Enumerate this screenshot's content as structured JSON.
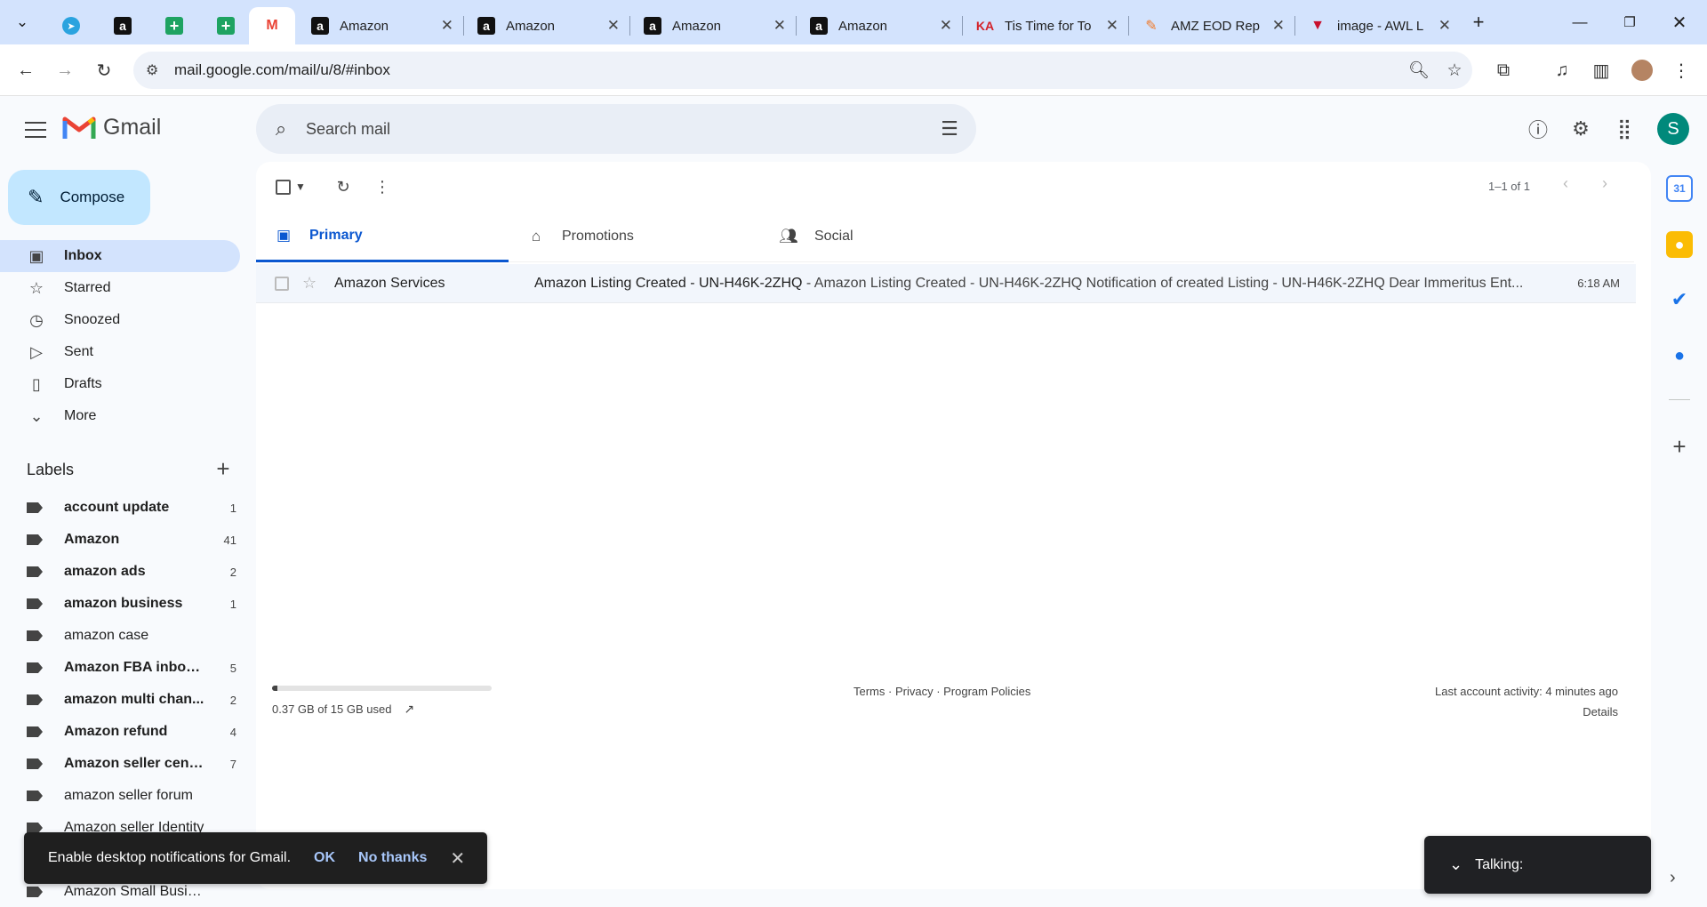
{
  "browser": {
    "tabs": [
      {
        "title": "",
        "favicon": "telegram-icon"
      },
      {
        "title": "",
        "favicon": "amazon-icon"
      },
      {
        "title": "",
        "favicon": "sheets-icon"
      },
      {
        "title": "",
        "favicon": "sheets-icon"
      },
      {
        "title": "",
        "favicon": "gmail-icon",
        "active": true
      },
      {
        "title": "Amazon",
        "favicon": "amazon-icon"
      },
      {
        "title": "Amazon",
        "favicon": "amazon-icon"
      },
      {
        "title": "Amazon",
        "favicon": "amazon-icon"
      },
      {
        "title": "Amazon",
        "favicon": "amazon-icon"
      },
      {
        "title": "Tis Time for To",
        "favicon": "ka-icon"
      },
      {
        "title": "AMZ EOD Rep",
        "favicon": "amz-eod-icon"
      },
      {
        "title": "image - AWL L",
        "favicon": "awl-icon"
      }
    ],
    "url": "mail.google.com/mail/u/8/#inbox"
  },
  "gmail": {
    "wordmark": "Gmail",
    "search_placeholder": "Search mail",
    "avatar_letter": "S",
    "compose_label": "Compose",
    "nav": [
      {
        "label": "Inbox",
        "icon": "inbox-icon",
        "active": true
      },
      {
        "label": "Starred",
        "icon": "star-icon"
      },
      {
        "label": "Snoozed",
        "icon": "clock-icon"
      },
      {
        "label": "Sent",
        "icon": "send-icon"
      },
      {
        "label": "Drafts",
        "icon": "draft-icon"
      },
      {
        "label": "More",
        "icon": "chevron-down-icon"
      }
    ],
    "labels_heading": "Labels",
    "labels": [
      {
        "name": "account update",
        "count": "1",
        "bold": true
      },
      {
        "name": "Amazon",
        "count": "41",
        "bold": true
      },
      {
        "name": "amazon ads",
        "count": "2",
        "bold": true
      },
      {
        "name": "amazon business",
        "count": "1",
        "bold": true
      },
      {
        "name": "amazon case",
        "count": "",
        "bold": false
      },
      {
        "name": "Amazon FBA inbou...",
        "count": "5",
        "bold": true
      },
      {
        "name": "amazon multi chan...",
        "count": "2",
        "bold": true
      },
      {
        "name": "Amazon refund",
        "count": "4",
        "bold": true
      },
      {
        "name": "Amazon seller cent...",
        "count": "7",
        "bold": true
      },
      {
        "name": "amazon seller forum",
        "count": "",
        "bold": false
      },
      {
        "name": "Amazon seller Identity",
        "count": "",
        "bold": false
      },
      {
        "name": "",
        "count": "",
        "bold": false
      },
      {
        "name": "Amazon Small Business",
        "count": "",
        "bold": false
      }
    ],
    "toolbar": {
      "page_info": "1–1 of 1"
    },
    "category_tabs": [
      {
        "label": "Primary",
        "icon": "inbox-icon",
        "active": true
      },
      {
        "label": "Promotions",
        "icon": "tag-icon"
      },
      {
        "label": "Social",
        "icon": "people-icon"
      }
    ],
    "emails": [
      {
        "sender": "Amazon Services",
        "subject": "Amazon Listing Created - UN-H46K-2ZHQ",
        "snippet": " - Amazon Listing Created - UN-H46K-2ZHQ Notification of created Listing - UN-H46K-2ZHQ Dear Immeritus Ent...",
        "time": "6:18 AM"
      }
    ],
    "storage": {
      "text": "0.37 GB of 15 GB used",
      "used_fraction": 0.025
    },
    "footer": {
      "terms": "Terms",
      "privacy": "Privacy",
      "policies": "Program Policies",
      "sep": " · ",
      "last_activity": "Last account activity: 4 minutes ago",
      "details": "Details"
    },
    "rail": [
      "calendar-icon",
      "keep-icon",
      "tasks-icon",
      "contacts-icon",
      "plus-icon"
    ]
  },
  "toast": {
    "message": "Enable desktop notifications for Gmail.",
    "ok": "OK",
    "no_thanks": "No thanks"
  },
  "talk": {
    "label": "Talking:"
  },
  "colors": {
    "accent": "#0b57d0",
    "compose": "#c2e7ff",
    "selected_nav": "#d3e3fd",
    "avatar": "#00897b"
  }
}
